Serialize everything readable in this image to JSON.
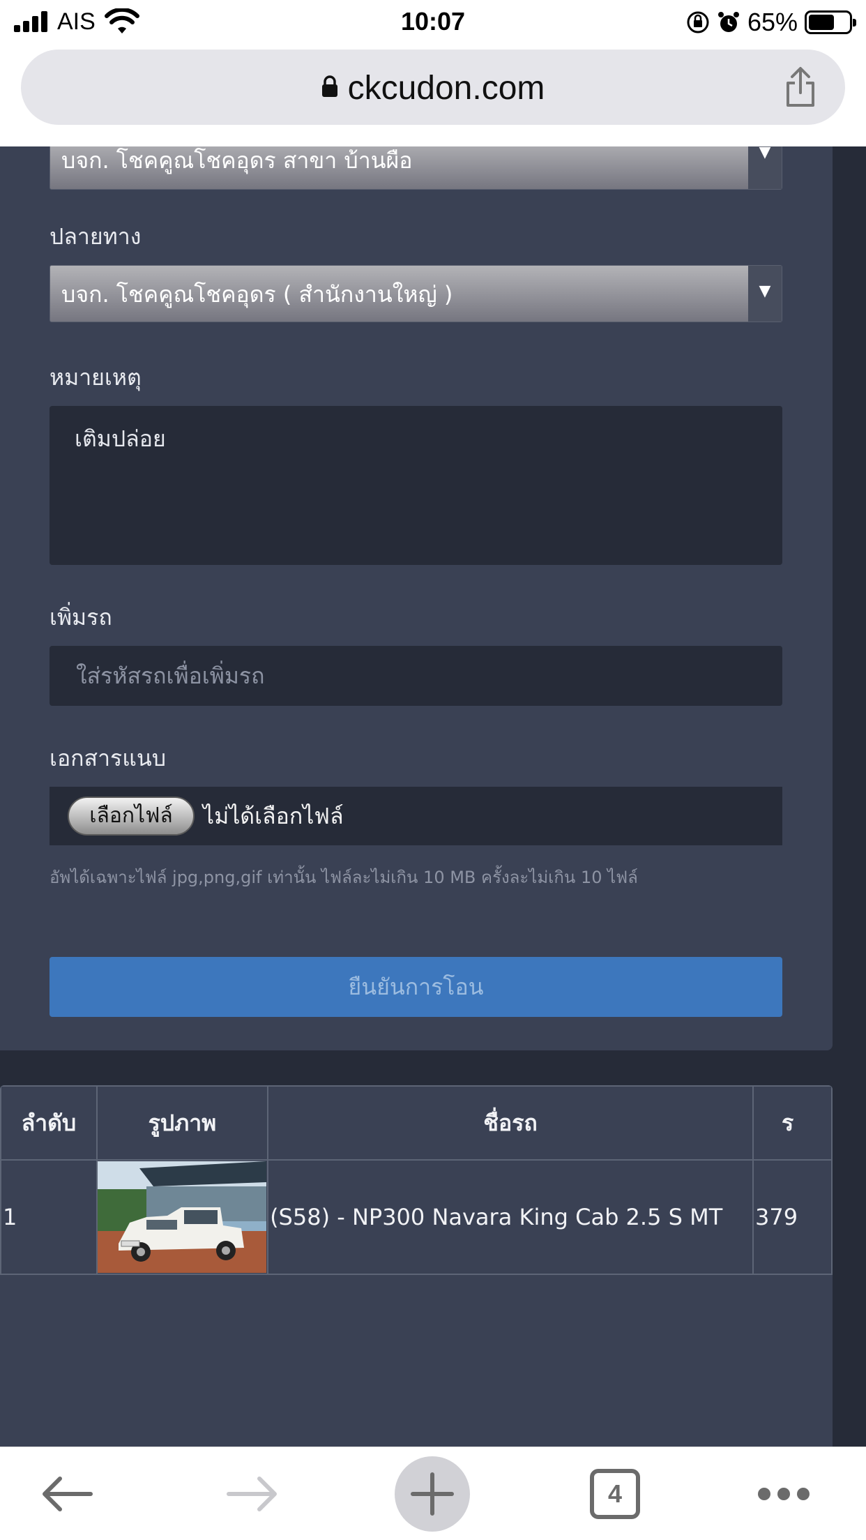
{
  "status_bar": {
    "carrier": "AIS",
    "time": "10:07",
    "battery": "65%",
    "battery_level": 0.65
  },
  "browser": {
    "url": "ckcudon.com",
    "tab_count": "4"
  },
  "form": {
    "origin_value": "บจก. โชคคูณโชคอุดร สาขา บ้านผือ",
    "destination_label": "ปลายทาง",
    "destination_value": "บจก. โชคคูณโชคอุดร ( สำนักงานใหญ่ )",
    "note_label": "หมายเหตุ",
    "note_value": "เติมปล่อย",
    "add_car_label": "เพิ่มรถ",
    "add_car_placeholder": "ใส่รหัสรถเพื่อเพิ่มรถ",
    "attachment_label": "เอกสารแนบ",
    "choose_file_button": "เลือกไฟล์",
    "no_file_text": "ไม่ได้เลือกไฟล์",
    "upload_hint": "อัพได้เฉพาะไฟล์ jpg,png,gif เท่านั้น ไฟล์ละไม่เกิน 10 MB ครั้งละไม่เกิน 10 ไฟล์",
    "submit_button": "ยืนยันการโอน"
  },
  "table": {
    "headers": [
      "ลำดับ",
      "รูปภาพ",
      "ชื่อรถ",
      "ร"
    ],
    "rows": [
      {
        "index": "1",
        "name": "(S58) - NP300 Navara King Cab 2.5 S MT",
        "price": "379"
      }
    ]
  },
  "icons": {
    "signal": "signal-icon",
    "wifi": "wifi-icon",
    "lock": "lock-icon",
    "share": "share-icon",
    "back": "back-arrow-icon",
    "forward": "forward-arrow-icon",
    "new_tab": "plus-icon",
    "tabs": "tabs-icon",
    "more": "more-icon",
    "dropdown": "dropdown-arrow-icon"
  }
}
